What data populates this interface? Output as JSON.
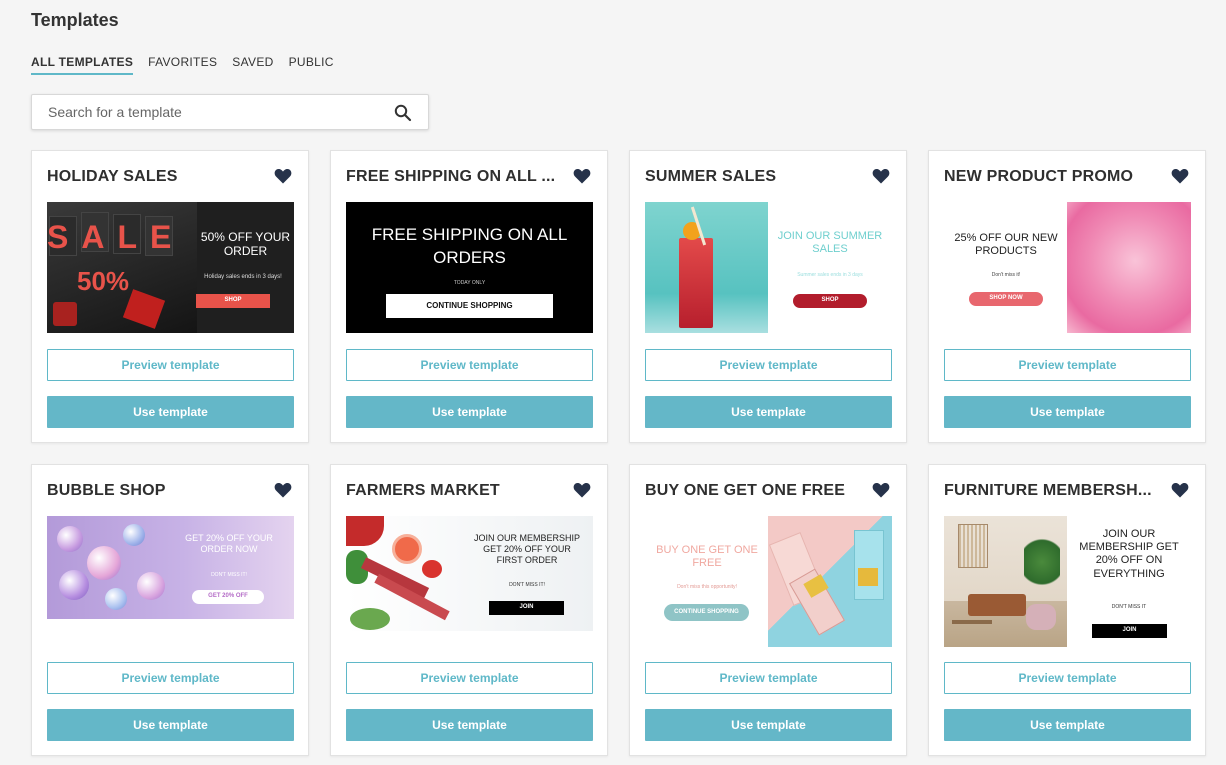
{
  "page": {
    "title": "Templates"
  },
  "tabs": [
    {
      "label": "ALL TEMPLATES",
      "active": true
    },
    {
      "label": "FAVORITES",
      "active": false
    },
    {
      "label": "SAVED",
      "active": false
    },
    {
      "label": "PUBLIC",
      "active": false
    }
  ],
  "search": {
    "placeholder": "Search for a template",
    "icon": "search-icon"
  },
  "buttons": {
    "preview": "Preview template",
    "use": "Use template"
  },
  "colors": {
    "accent": "#64b7c8",
    "heart": "#26324a"
  },
  "templates": [
    {
      "title": "HOLIDAY SALES",
      "heading": "50% OFF YOUR ORDER",
      "sub": "Holiday sales ends in 3 days!",
      "cta": "SHOP",
      "art": "SALE",
      "art2": "50%"
    },
    {
      "title": "FREE SHIPPING ON ALL ...",
      "heading": "FREE SHIPPING ON ALL ORDERS",
      "sub": "TODAY ONLY",
      "cta": "CONTINUE SHOPPING"
    },
    {
      "title": "SUMMER SALES",
      "heading": "JOIN OUR SUMMER SALES",
      "sub": "Summer sales ends in 3 days",
      "cta": "SHOP"
    },
    {
      "title": "NEW PRODUCT PROMO",
      "heading": "25% OFF OUR NEW PRODUCTS",
      "sub": "Don't miss it!",
      "cta": "SHOP NOW"
    },
    {
      "title": "BUBBLE SHOP",
      "heading": "GET 20% OFF YOUR ORDER NOW",
      "sub": "DON'T MISS IT!",
      "cta": "GET 20% OFF"
    },
    {
      "title": "FARMERS MARKET",
      "heading": "JOIN OUR MEMBERSHIP GET 20% OFF YOUR FIRST ORDER",
      "sub": "DON'T MISS IT!",
      "cta": "JOIN"
    },
    {
      "title": "BUY ONE GET ONE FREE",
      "heading": "BUY ONE GET ONE FREE",
      "sub": "Don't miss this opportunity!",
      "cta": "CONTINUE SHOPPING"
    },
    {
      "title": "FURNITURE MEMBERSH...",
      "heading": "JOIN OUR MEMBERSHIP GET 20% OFF ON EVERYTHING",
      "sub": "DON'T MISS IT",
      "cta": "JOIN"
    }
  ]
}
